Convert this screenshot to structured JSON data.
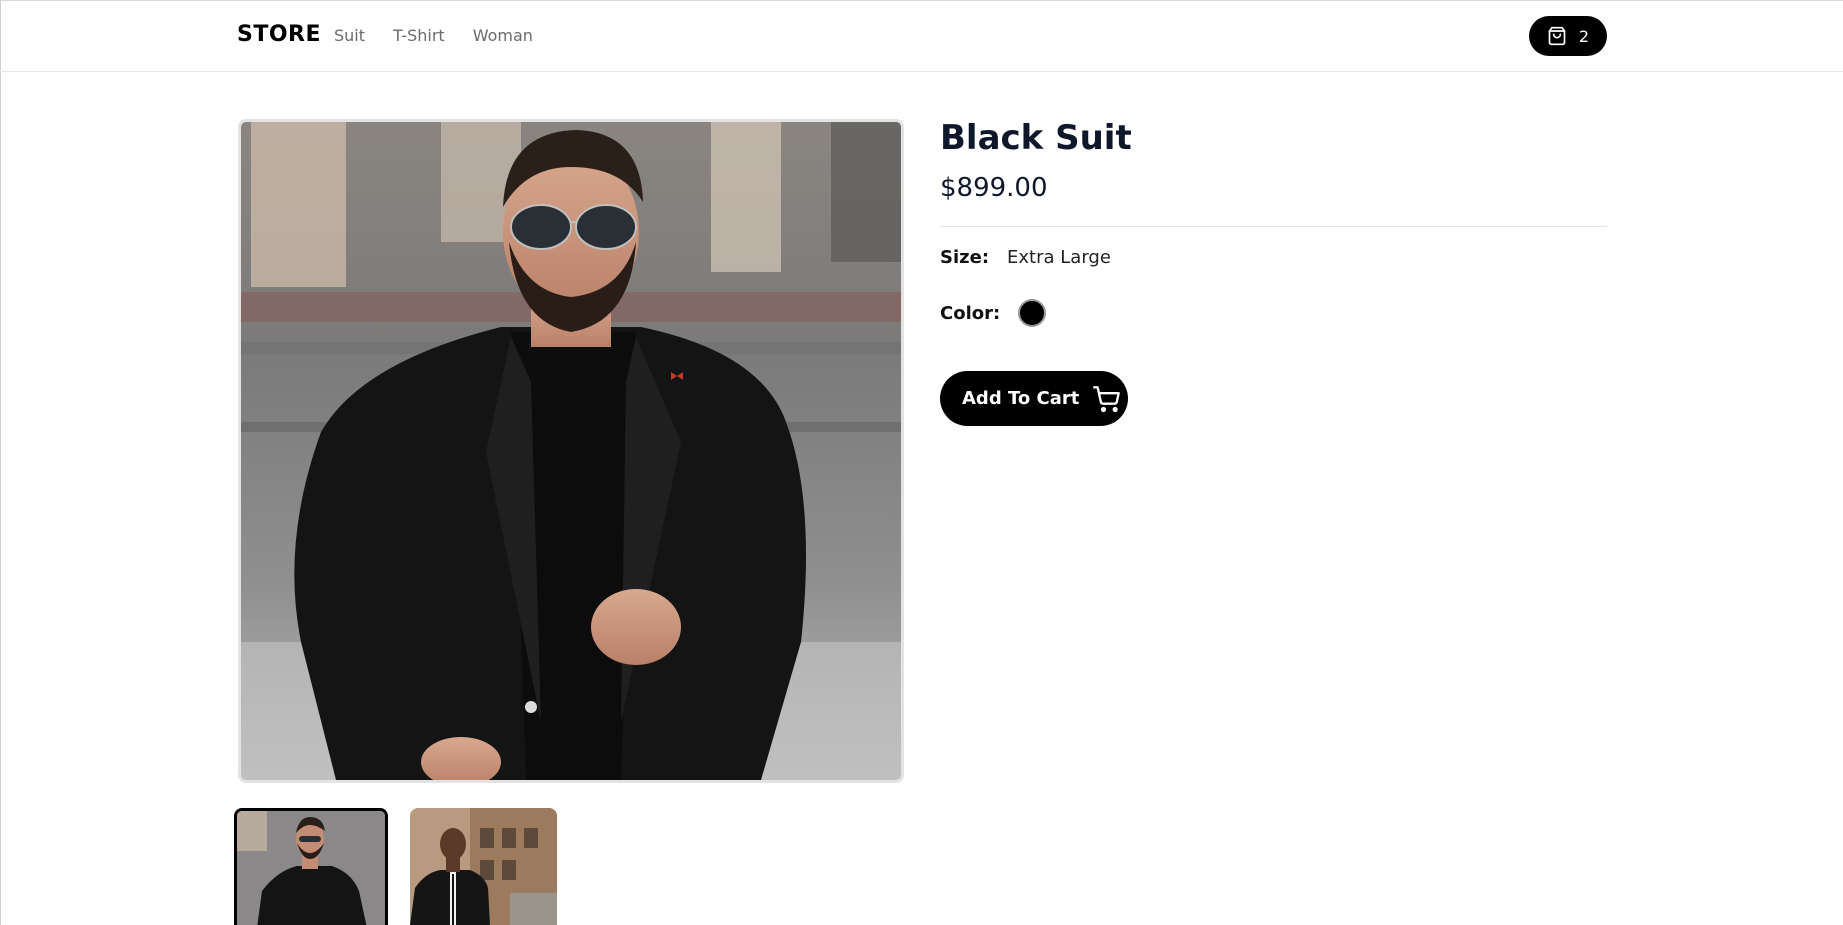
{
  "header": {
    "logo": "STORE",
    "nav": [
      {
        "label": "Suit"
      },
      {
        "label": "T-Shirt"
      },
      {
        "label": "Woman"
      }
    ],
    "cart_count": "2"
  },
  "product": {
    "title": "Black Suit",
    "price": "$899.00",
    "size_label": "Size:",
    "size_value": "Extra Large",
    "color_label": "Color:",
    "color_value_hex": "#000000",
    "add_to_cart_label": "Add To Cart"
  },
  "gallery": {
    "main_image": "man-in-black-suit-with-sunglasses-photo",
    "thumbnails": [
      "man-in-black-suit-thumbnail",
      "man-in-black-suit-street-thumbnail"
    ],
    "selected_index": 0
  },
  "colors": {
    "accent": "#000000",
    "title": "#0f172a",
    "nav_text": "#6b6b6b",
    "divider": "#e5e5e5"
  }
}
